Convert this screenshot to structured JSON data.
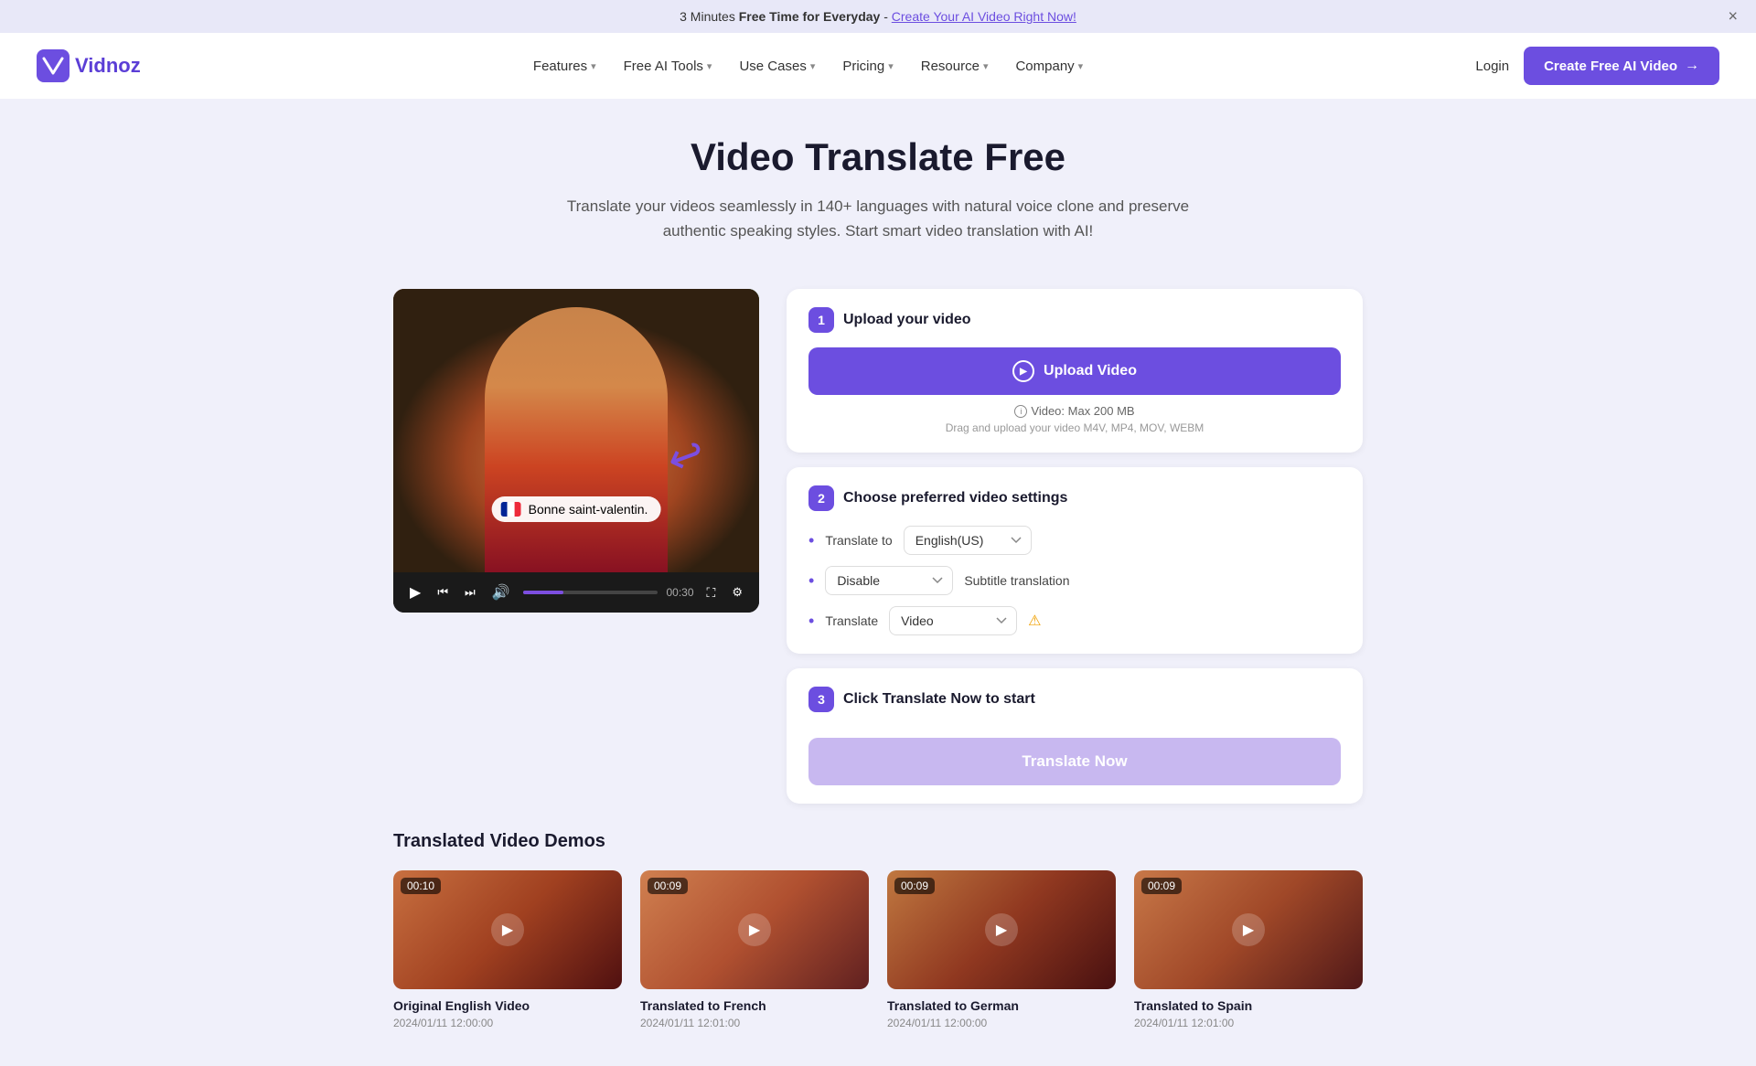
{
  "banner": {
    "text": "3 Minutes ",
    "highlight": "Free Time for Everyday",
    "separator": " - ",
    "link_text": "Create Your AI Video Right Now!"
  },
  "nav": {
    "logo_text": "Vidnoz",
    "links": [
      {
        "label": "Features",
        "has_dropdown": true
      },
      {
        "label": "Free AI Tools",
        "has_dropdown": true
      },
      {
        "label": "Use Cases",
        "has_dropdown": true
      },
      {
        "label": "Pricing",
        "has_dropdown": true
      },
      {
        "label": "Resource",
        "has_dropdown": true
      },
      {
        "label": "Company",
        "has_dropdown": true
      }
    ],
    "login_label": "Login",
    "cta_label": "Create Free AI Video"
  },
  "hero": {
    "title": "Video Translate Free",
    "subtitle": "Translate your videos seamlessly in 140+ languages with natural voice clone and preserve authentic speaking styles. Start smart video translation with AI!"
  },
  "video": {
    "subtitle_text": "Bonne saint-valentin.",
    "duration": "00:30"
  },
  "steps": {
    "step1": {
      "number": "1",
      "title": "Upload your video",
      "upload_btn": "Upload Video",
      "max_size": "Video: Max 200 MB",
      "formats": "Drag and upload your video M4V, MP4, MOV, WEBM"
    },
    "step2": {
      "number": "2",
      "title": "Choose preferred video settings",
      "translate_to_label": "Translate to",
      "translate_to_value": "English(US)",
      "subtitle_label": "Subtitle translation",
      "subtitle_value": "Disable",
      "translate_label": "Translate",
      "translate_value": "Video"
    },
    "step3": {
      "number": "3",
      "title": "Click Translate Now to start",
      "cta_label": "Translate Now"
    }
  },
  "demos": {
    "section_title": "Translated Video Demos",
    "items": [
      {
        "name": "Original English Video",
        "date": "2024/01/11 12:00:00",
        "duration": "00:10",
        "thumb_class": "demo-thumb-1"
      },
      {
        "name": "Translated to French",
        "date": "2024/01/11 12:01:00",
        "duration": "00:09",
        "thumb_class": "demo-thumb-2"
      },
      {
        "name": "Translated to German",
        "date": "2024/01/11 12:00:00",
        "duration": "00:09",
        "thumb_class": "demo-thumb-3"
      },
      {
        "name": "Translated to Spain",
        "date": "2024/01/11 12:01:00",
        "duration": "00:09",
        "thumb_class": "demo-thumb-4"
      }
    ]
  },
  "icons": {
    "play": "▶",
    "rewind": "⏪",
    "forward": "⏩",
    "volume": "🔊",
    "expand": "⛶",
    "chevron_down": "▾",
    "arrow_right": "→",
    "info": "ℹ",
    "info_yellow": "⚠"
  }
}
